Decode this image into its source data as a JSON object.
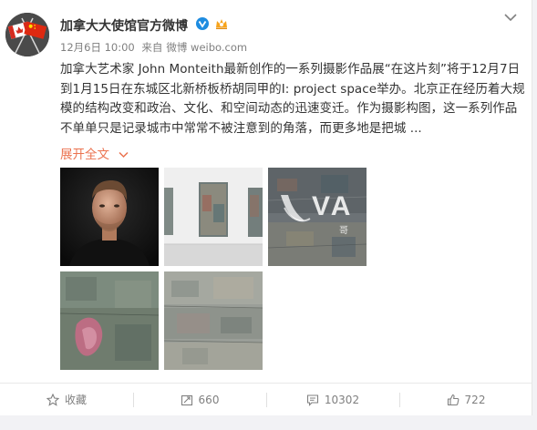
{
  "post": {
    "author": "加拿大大使馆官方微博",
    "time": "12月6日 10:00",
    "source_prefix": "来自",
    "source": "微博 weibo.com",
    "text": "加拿大艺术家 John Monteith最新创作的一系列摄影作品展“在这片刻”将于12月7日到1月15日在东城区北新桥板桥胡同甲的I: project space举办。北京正在经历着大规模的结构改变和政治、文化、和空间动态的迅速变迁。作为摄影构图，这一系列作品不单单只是记录城市中常常不被注意到的角落，而更多地是把城 ...",
    "expand_label": "展开全文",
    "watermark": "VA",
    "watermark_sub": "哥"
  },
  "images": [
    {
      "name": "portrait"
    },
    {
      "name": "gallery-wall"
    },
    {
      "name": "texture-1"
    },
    {
      "name": "texture-2"
    },
    {
      "name": "texture-3"
    }
  ],
  "actions": {
    "favorite_label": "收藏",
    "repost_count": "660",
    "comment_count": "10302",
    "like_count": "722"
  },
  "colors": {
    "accent": "#eb7350",
    "verified": "#1e8ce0",
    "muted": "#808080"
  }
}
